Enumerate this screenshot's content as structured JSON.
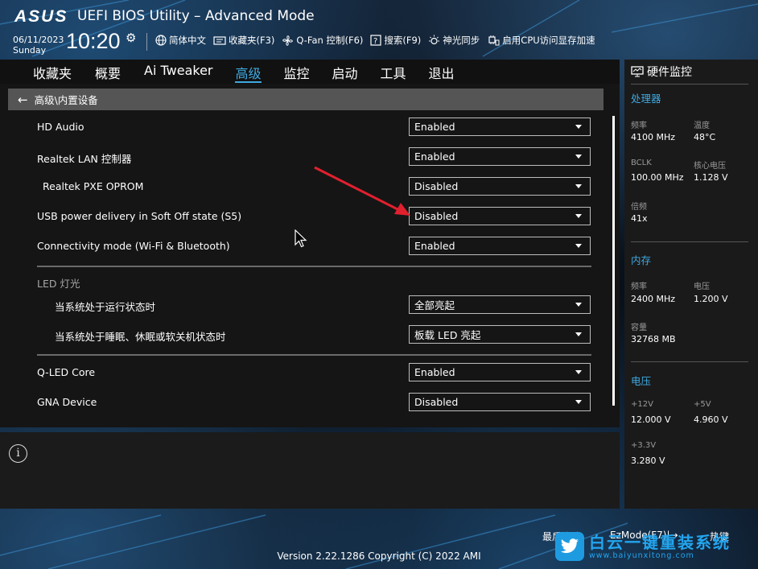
{
  "header": {
    "brand": "ASUS",
    "title": "UEFI BIOS Utility – Advanced Mode",
    "date": "06/11/2023",
    "weekday": "Sunday",
    "time": "10:20"
  },
  "toolbar": {
    "language": "简体中文",
    "favorites": "收藏夹(F3)",
    "qfan": "Q-Fan 控制(F6)",
    "search": "搜索(F9)",
    "aura": "神光同步",
    "resizable_bar": "启用CPU访问显存加速"
  },
  "tabs": [
    {
      "label": "收藏夹"
    },
    {
      "label": "概要"
    },
    {
      "label": "Ai Tweaker"
    },
    {
      "label": "高级",
      "active": true
    },
    {
      "label": "监控"
    },
    {
      "label": "启动"
    },
    {
      "label": "工具"
    },
    {
      "label": "退出"
    }
  ],
  "breadcrumb": "高级\\内置设备",
  "settings": [
    {
      "label": "HD Audio",
      "value": "Enabled"
    },
    {
      "label": "Realtek LAN 控制器",
      "value": "Enabled"
    },
    {
      "label": "Realtek PXE OPROM",
      "value": "Disabled"
    },
    {
      "label": "USB power delivery in Soft Off state (S5)",
      "value": "Disabled"
    },
    {
      "label": "Connectivity mode (Wi-Fi & Bluetooth)",
      "value": "Enabled"
    },
    {
      "label": "当系统处于运行状态时",
      "value": "全部亮起"
    },
    {
      "label": "当系统处于睡眠、休眠或软关机状态时",
      "value": "板载 LED 亮起"
    },
    {
      "label": "Q-LED Core",
      "value": "Enabled"
    },
    {
      "label": "GNA Device",
      "value": "Disabled"
    }
  ],
  "led_section": "LED 灯光",
  "help_icon": "info-icon",
  "hw_monitor": {
    "title": "硬件监控",
    "cpu": {
      "section": "处理器",
      "freq_label": "频率",
      "freq": "4100 MHz",
      "temp_label": "温度",
      "temp": "48°C",
      "bclk_label": "BCLK",
      "bclk": "100.00 MHz",
      "vcore_label": "核心电压",
      "vcore": "1.128 V",
      "ratio_label": "倍频",
      "ratio": "41x"
    },
    "memory": {
      "section": "内存",
      "freq_label": "频率",
      "freq": "2400 MHz",
      "volt_label": "电压",
      "volt": "1.200 V",
      "cap_label": "容量",
      "cap": "32768 MB"
    },
    "voltage": {
      "section": "电压",
      "v12_label": "+12V",
      "v12": "12.000 V",
      "v5_label": "+5V",
      "v5": "4.960 V",
      "v33_label": "+3.3V",
      "v33": "3.280 V"
    }
  },
  "footer": {
    "last_modified": "最后修改",
    "ezmode": "EzMode(F7)|→",
    "hotkeys": "热键",
    "version": "Version 2.22.1286 Copyright (C) 2022 AMI"
  },
  "watermark": {
    "name": "白云一键重装系统",
    "url": "www.baiyunxitong.com"
  },
  "colors": {
    "accent": "#3fa9e0",
    "panel": "#151515",
    "annotation_arrow": "#e0202e"
  }
}
